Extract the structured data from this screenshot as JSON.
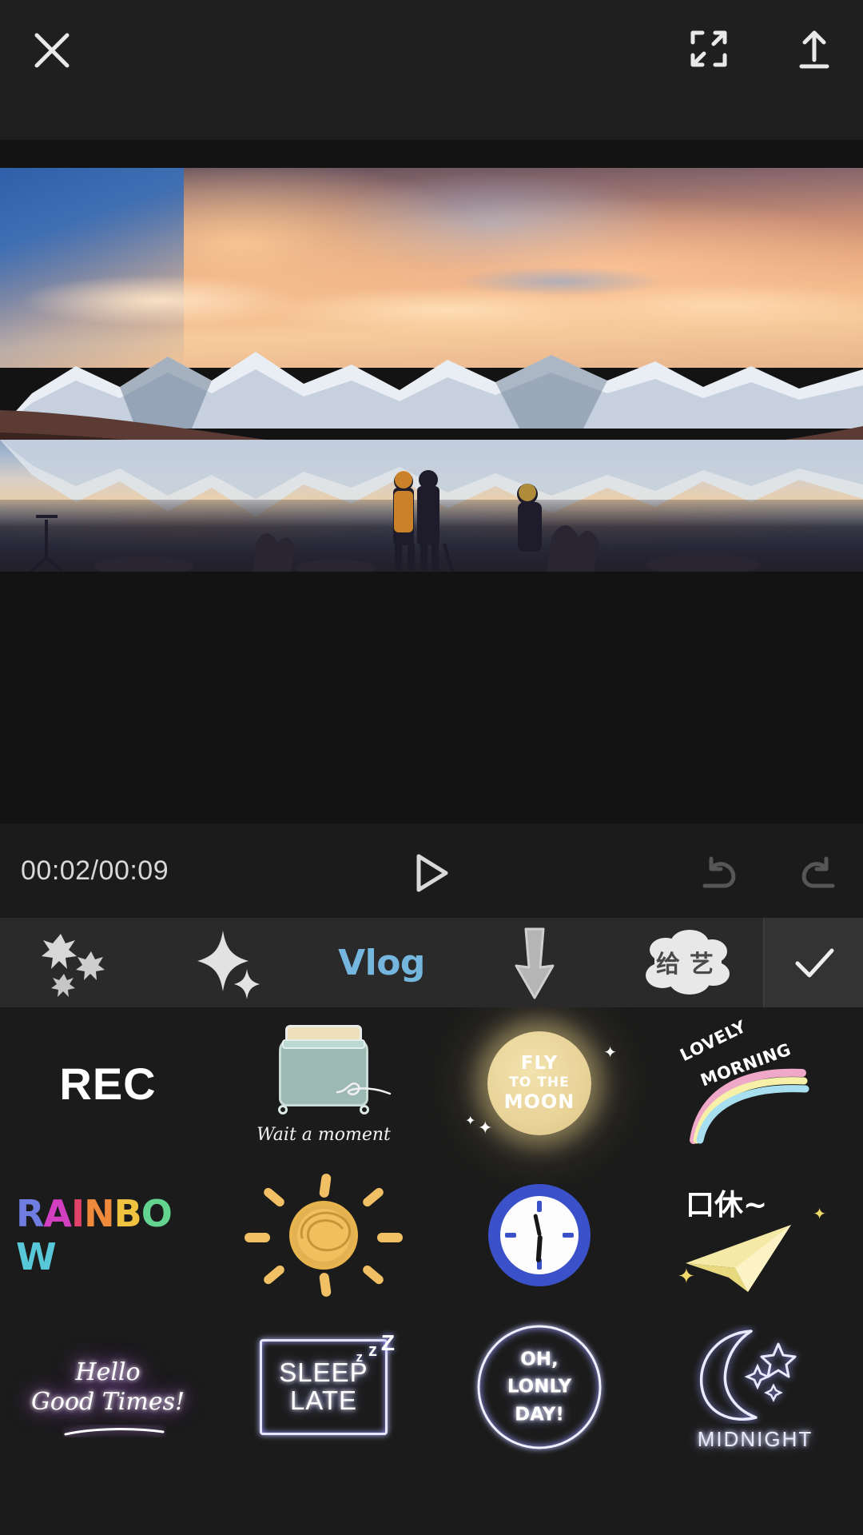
{
  "app": {
    "background_color": "#1b1b1b",
    "accent_color": "#74b6dd"
  },
  "topbar": {
    "close_label": "close-icon",
    "fullscreen_label": "fullscreen-icon",
    "export_label": "export-icon"
  },
  "preview": {
    "scene_description": "Sunset over snow-capped mountains reflected in an alpine lake with silhouetted photographers on the rocky shore"
  },
  "playback": {
    "timecode": "00:02/00:09",
    "current_time": "00:02",
    "total_time": "00:09",
    "play_label": "play-icon",
    "undo_label": "undo-icon",
    "redo_label": "redo-icon"
  },
  "tabs": {
    "selected": "Vlog",
    "items": [
      {
        "id": "sparkle-burst",
        "label": "",
        "icon": "snowflake-burst-icon",
        "type": "icon",
        "selected": false
      },
      {
        "id": "sparkle",
        "label": "",
        "icon": "sparkle-icon",
        "type": "icon",
        "selected": false
      },
      {
        "id": "vlog",
        "label": "Vlog",
        "icon": "",
        "type": "text",
        "selected": true
      },
      {
        "id": "arrow",
        "label": "",
        "icon": "down-arrow-icon",
        "type": "icon",
        "selected": false
      },
      {
        "id": "cn-text",
        "label": "给艺",
        "icon": "chinese-text-sticker-icon",
        "type": "icon",
        "selected": false
      }
    ],
    "confirm_label": "check-icon"
  },
  "stickers": {
    "rows": [
      [
        {
          "id": "rec",
          "name": "rec-sticker",
          "text": "REC",
          "caption": ""
        },
        {
          "id": "toaster",
          "name": "toaster-sticker",
          "text": "",
          "caption": "Wait a moment"
        },
        {
          "id": "moon",
          "name": "fly-to-the-moon-sticker",
          "line1": "FLY",
          "line2": "TO THE",
          "line3": "MOON",
          "caption": ""
        },
        {
          "id": "lovely-morning",
          "name": "lovely-morning-sticker",
          "line1": "LOVELY",
          "line2": "MORNING",
          "caption": ""
        }
      ],
      [
        {
          "id": "rainbow",
          "name": "rainbow-text-sticker",
          "text": "RAINBOW",
          "caption": ""
        },
        {
          "id": "sun",
          "name": "sun-doodle-sticker",
          "text": "",
          "caption": ""
        },
        {
          "id": "clock",
          "name": "clock-sticker",
          "text": "",
          "caption": ""
        },
        {
          "id": "cn-break",
          "name": "chinese-break-plane-sticker",
          "text": "口休~",
          "caption": ""
        }
      ],
      [
        {
          "id": "hello-good-times",
          "name": "hello-good-times-sticker",
          "line1": "Hello",
          "line2": "Good Times!",
          "caption": ""
        },
        {
          "id": "sleep-late",
          "name": "sleep-late-sticker",
          "line1": "SLEEP",
          "line2": "LATE",
          "caption": ""
        },
        {
          "id": "oh-lonly-day",
          "name": "oh-lonly-day-sticker",
          "line1": "OH,",
          "line2": "LONLY",
          "line3": "DAY!",
          "caption": ""
        },
        {
          "id": "midnight",
          "name": "midnight-moon-sticker",
          "text": "",
          "caption": "MIDNIGHT"
        }
      ]
    ],
    "rainbow_letters": [
      {
        "ch": "R",
        "color": "#6f7ce0"
      },
      {
        "ch": "A",
        "color": "#d23fc0"
      },
      {
        "ch": "I",
        "color": "#e0446a"
      },
      {
        "ch": "N",
        "color": "#ef8a3c"
      },
      {
        "ch": "B",
        "color": "#efc240"
      },
      {
        "ch": "O",
        "color": "#63d48f"
      },
      {
        "ch": "W",
        "color": "#58c8d8"
      }
    ]
  }
}
